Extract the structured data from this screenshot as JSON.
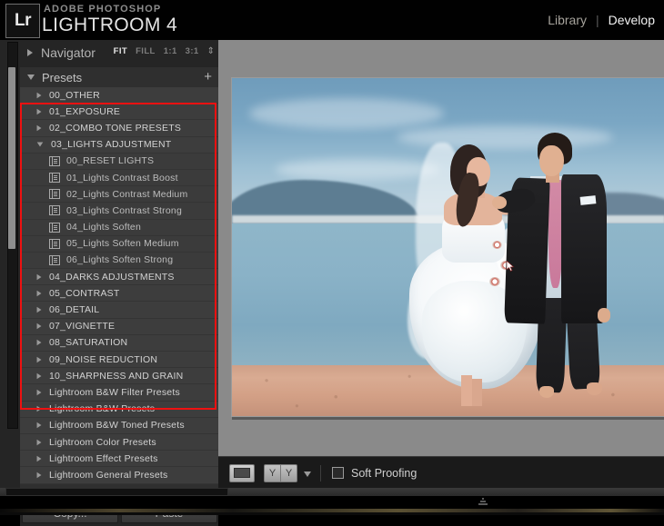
{
  "app": {
    "logo_text": "Lr",
    "brand_small": "ADOBE PHOTOSHOP",
    "brand_big": "LIGHTROOM 4"
  },
  "modules": {
    "items": [
      {
        "label": "Library",
        "active": false
      },
      {
        "label": "Develop",
        "active": true
      }
    ],
    "separator": "|"
  },
  "navigator": {
    "label": "Navigator",
    "disclosure": "triangle-right",
    "zoom_levels": [
      {
        "label": "FIT",
        "selected": true
      },
      {
        "label": "FILL",
        "selected": false
      },
      {
        "label": "1:1",
        "selected": false
      },
      {
        "label": "3:1",
        "selected": false
      }
    ],
    "stepper": "⇕"
  },
  "presets": {
    "title": "Presets",
    "disclosure": "triangle-down",
    "add_label": "+",
    "tree": [
      {
        "label": "00_OTHER",
        "type": "group",
        "expanded": false,
        "in_highlight": true
      },
      {
        "label": "01_EXPOSURE",
        "type": "group",
        "expanded": false,
        "in_highlight": true
      },
      {
        "label": "02_COMBO TONE PRESETS",
        "type": "group",
        "expanded": false,
        "in_highlight": true
      },
      {
        "label": "03_LIGHTS ADJUSTMENT",
        "type": "group",
        "expanded": true,
        "in_highlight": true
      },
      {
        "label": "00_RESET LIGHTS",
        "type": "preset",
        "in_highlight": true
      },
      {
        "label": "01_Lights Contrast Boost",
        "type": "preset",
        "in_highlight": true
      },
      {
        "label": "02_Lights Contrast Medium",
        "type": "preset",
        "in_highlight": true
      },
      {
        "label": "03_Lights Contrast Strong",
        "type": "preset",
        "in_highlight": true
      },
      {
        "label": "04_Lights Soften",
        "type": "preset",
        "in_highlight": true
      },
      {
        "label": "05_Lights Soften Medium",
        "type": "preset",
        "in_highlight": true
      },
      {
        "label": "06_Lights Soften Strong",
        "type": "preset",
        "in_highlight": true
      },
      {
        "label": "04_DARKS ADJUSTMENTS",
        "type": "group",
        "expanded": false,
        "in_highlight": true
      },
      {
        "label": "05_CONTRAST",
        "type": "group",
        "expanded": false,
        "in_highlight": true
      },
      {
        "label": "06_DETAIL",
        "type": "group",
        "expanded": false,
        "in_highlight": true
      },
      {
        "label": "07_VIGNETTE",
        "type": "group",
        "expanded": false,
        "in_highlight": true
      },
      {
        "label": "08_SATURATION",
        "type": "group",
        "expanded": false,
        "in_highlight": true
      },
      {
        "label": "09_NOISE REDUCTION",
        "type": "group",
        "expanded": false,
        "in_highlight": true
      },
      {
        "label": "10_SHARPNESS AND GRAIN",
        "type": "group",
        "expanded": false,
        "in_highlight": true
      },
      {
        "label": "Lightroom B&W Filter Presets",
        "type": "group",
        "expanded": false,
        "in_highlight": false
      },
      {
        "label": "Lightroom B&W Presets",
        "type": "group",
        "expanded": false,
        "in_highlight": false
      },
      {
        "label": "Lightroom B&W Toned Presets",
        "type": "group",
        "expanded": false,
        "in_highlight": false
      },
      {
        "label": "Lightroom Color Presets",
        "type": "group",
        "expanded": false,
        "in_highlight": false
      },
      {
        "label": "Lightroom Effect Presets",
        "type": "group",
        "expanded": false,
        "in_highlight": false
      },
      {
        "label": "Lightroom General Presets",
        "type": "group",
        "expanded": false,
        "in_highlight": false
      }
    ]
  },
  "highlight": {
    "color": "#ee1111",
    "note": "red annotation rectangle around custom preset folders"
  },
  "panel_footer": {
    "copy_label": "Copy...",
    "paste_label": "Paste"
  },
  "photo": {
    "description": "Bride in white gown and groom in dark suit walking barefoot on a sandy beach beside blue water",
    "alt": "wedding-photo-beach"
  },
  "toolbar": {
    "view_loupe": "loupe-view",
    "compare_left": "Y",
    "compare_right": "Y",
    "caret": "▾",
    "soft_proofing_label": "Soft Proofing",
    "soft_proofing_checked": false
  },
  "filmstrip": {
    "handle": "collapse-handle"
  }
}
